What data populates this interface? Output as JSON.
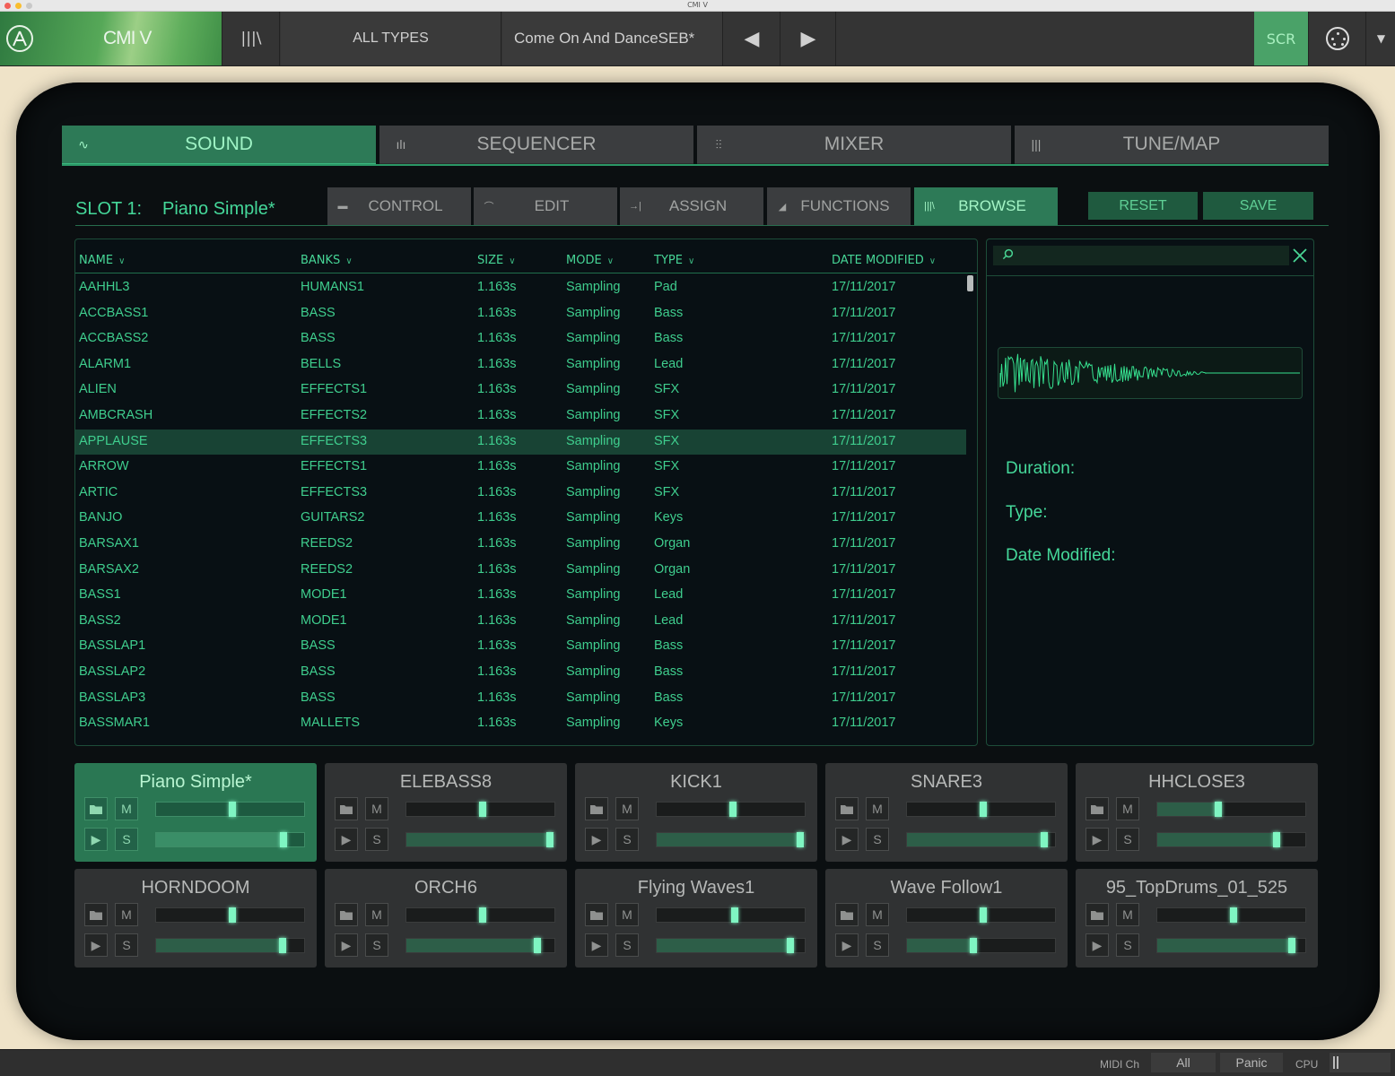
{
  "window": {
    "title": "CMI V"
  },
  "toolbar": {
    "app_name": "CMI V",
    "library_icon": "|||\\",
    "types_filter": "ALL TYPES",
    "preset_name": "Come On And DanceSEB*",
    "prev_glyph": "◀",
    "next_glyph": "▶",
    "scr_label": "SCR",
    "menu_glyph": "▼",
    "accent": "#4aa268"
  },
  "main_tabs": [
    {
      "label": "SOUND",
      "icon": "waveform-icon",
      "glyph": "∿"
    },
    {
      "label": "SEQUENCER",
      "icon": "bars-icon",
      "glyph": "ılı"
    },
    {
      "label": "MIXER",
      "icon": "faders-icon",
      "glyph": "⫶⫶"
    },
    {
      "label": "TUNE/MAP",
      "icon": "keys-icon",
      "glyph": "|||"
    }
  ],
  "slot": {
    "label": "SLOT 1:",
    "name": "Piano Simple*"
  },
  "sub_tabs": [
    {
      "label": "CONTROL",
      "icon": "control-icon",
      "glyph": "▬"
    },
    {
      "label": "EDIT",
      "icon": "envelope-icon",
      "glyph": "⌒"
    },
    {
      "label": "ASSIGN",
      "icon": "assign-icon",
      "glyph": "→|"
    },
    {
      "label": "FUNCTIONS",
      "icon": "functions-icon",
      "glyph": "◢"
    },
    {
      "label": "BROWSE",
      "icon": "library-icon",
      "glyph": "|||\\"
    }
  ],
  "actions": {
    "reset": "RESET",
    "save": "SAVE"
  },
  "browser": {
    "columns": [
      "NAME",
      "BANKS",
      "SIZE",
      "MODE",
      "TYPE",
      "DATE MODIFIED"
    ],
    "rows": [
      [
        "AAHHL3",
        "HUMANS1",
        "1.163s",
        "Sampling",
        "Pad",
        "17/11/2017"
      ],
      [
        "ACCBASS1",
        "BASS",
        "1.163s",
        "Sampling",
        "Bass",
        "17/11/2017"
      ],
      [
        "ACCBASS2",
        "BASS",
        "1.163s",
        "Sampling",
        "Bass",
        "17/11/2017"
      ],
      [
        "ALARM1",
        "BELLS",
        "1.163s",
        "Sampling",
        "Lead",
        "17/11/2017"
      ],
      [
        "ALIEN",
        "EFFECTS1",
        "1.163s",
        "Sampling",
        "SFX",
        "17/11/2017"
      ],
      [
        "AMBCRASH",
        "EFFECTS2",
        "1.163s",
        "Sampling",
        "SFX",
        "17/11/2017"
      ],
      [
        "APPLAUSE",
        "EFFECTS3",
        "1.163s",
        "Sampling",
        "SFX",
        "17/11/2017"
      ],
      [
        "ARROW",
        "EFFECTS1",
        "1.163s",
        "Sampling",
        "SFX",
        "17/11/2017"
      ],
      [
        "ARTIC",
        "EFFECTS3",
        "1.163s",
        "Sampling",
        "SFX",
        "17/11/2017"
      ],
      [
        "BANJO",
        "GUITARS2",
        "1.163s",
        "Sampling",
        "Keys",
        "17/11/2017"
      ],
      [
        "BARSAX1",
        "REEDS2",
        "1.163s",
        "Sampling",
        "Organ",
        "17/11/2017"
      ],
      [
        "BARSAX2",
        "REEDS2",
        "1.163s",
        "Sampling",
        "Organ",
        "17/11/2017"
      ],
      [
        "BASS1",
        "MODE1",
        "1.163s",
        "Sampling",
        "Lead",
        "17/11/2017"
      ],
      [
        "BASS2",
        "MODE1",
        "1.163s",
        "Sampling",
        "Lead",
        "17/11/2017"
      ],
      [
        "BASSLAP1",
        "BASS",
        "1.163s",
        "Sampling",
        "Bass",
        "17/11/2017"
      ],
      [
        "BASSLAP2",
        "BASS",
        "1.163s",
        "Sampling",
        "Bass",
        "17/11/2017"
      ],
      [
        "BASSLAP3",
        "BASS",
        "1.163s",
        "Sampling",
        "Bass",
        "17/11/2017"
      ],
      [
        "BASSMAR1",
        "MALLETS",
        "1.163s",
        "Sampling",
        "Keys",
        "17/11/2017"
      ]
    ],
    "selected_index": 6
  },
  "preview": {
    "duration_label": "Duration:",
    "type_label": "Type:",
    "date_label": "Date Modified:"
  },
  "pads": [
    {
      "name": "Piano Simple*",
      "active": true,
      "top": 0.51,
      "bottom": 0.87
    },
    {
      "name": "ELEBASS8",
      "active": false,
      "top": 0.51,
      "bottom": 0.98
    },
    {
      "name": "KICK1",
      "active": false,
      "top": 0.51,
      "bottom": 0.98
    },
    {
      "name": "SNARE3",
      "active": false,
      "top": 0.51,
      "bottom": 0.94
    },
    {
      "name": "HHCLOSE3",
      "active": false,
      "top": 0.4,
      "bottom": 0.81
    },
    {
      "name": "HORNDOOM",
      "active": false,
      "top": 0.51,
      "bottom": 0.86
    },
    {
      "name": "ORCH6",
      "active": false,
      "top": 0.51,
      "bottom": 0.89
    },
    {
      "name": "Flying Waves1",
      "active": false,
      "top": 0.52,
      "bottom": 0.91
    },
    {
      "name": "Wave Follow1",
      "active": false,
      "top": 0.51,
      "bottom": 0.44
    },
    {
      "name": "95_TopDrums_01_525",
      "active": false,
      "top": 0.51,
      "bottom": 0.92
    }
  ],
  "pad_buttons": {
    "folder_icon": "folder-icon",
    "mute": "M",
    "play_glyph": "▶",
    "solo": "S"
  },
  "statusbar": {
    "midi_label": "MIDI Ch",
    "midi_value": "All",
    "panic": "Panic",
    "cpu_label": "CPU"
  }
}
